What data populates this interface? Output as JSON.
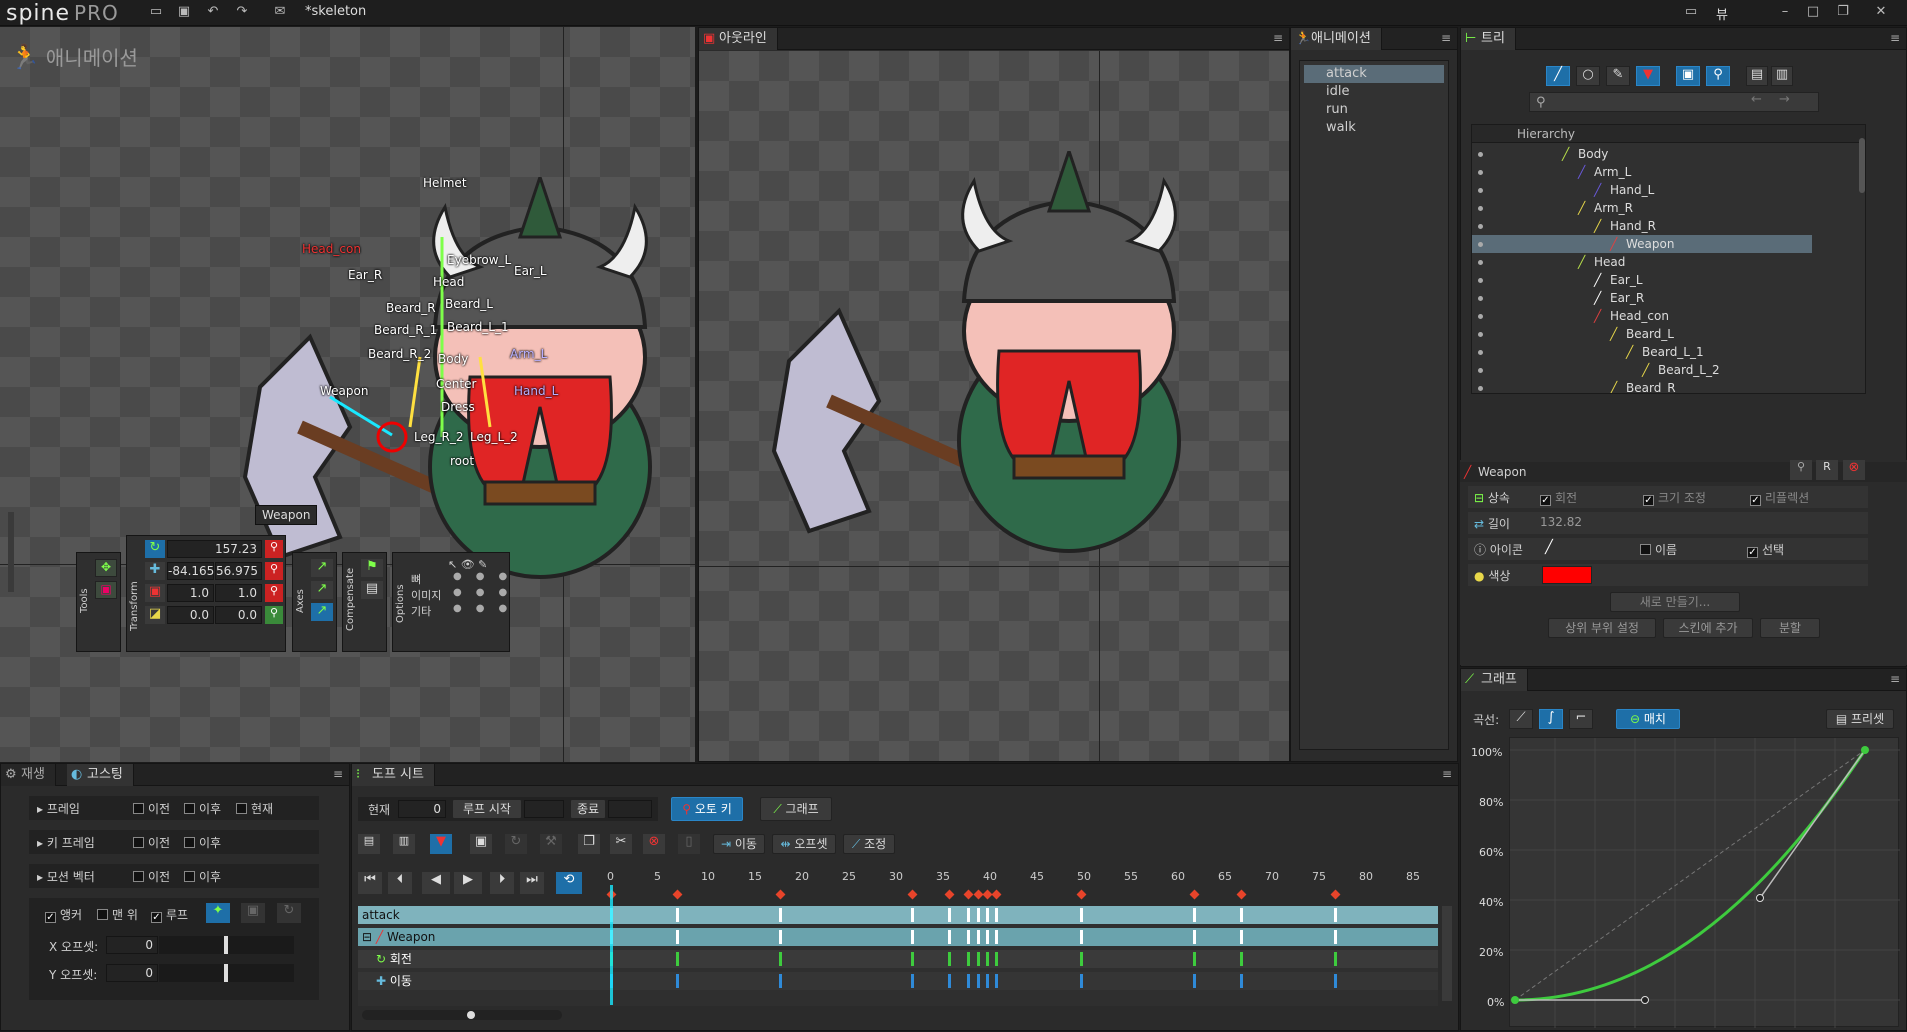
{
  "app": {
    "logo_main": "spine",
    "logo_pro": "PRO",
    "project": "*skeleton",
    "view_menu": "뷰"
  },
  "viewport": {
    "mode_label": "애니메이션",
    "selected_tag": "Weapon",
    "bones": [
      "Helmet",
      "Head_con",
      "Ear_R",
      "Eyebrow_L",
      "Ear_L",
      "Head",
      "Beard_R",
      "Beard_L",
      "Beard_R_1",
      "Beard_L_1",
      "Beard_R_2",
      "Arm_L",
      "Body",
      "Weapon",
      "Center",
      "Hand_L",
      "Dress",
      "Leg_R_2",
      "Leg_L_2",
      "root"
    ]
  },
  "transform": {
    "tools_label": "Tools",
    "transform_label": "Transform",
    "axes_label": "Axes",
    "compensate_label": "Compensate",
    "options_label": "Options",
    "rotate": "157.23",
    "translate_x": "-84.165",
    "translate_y": "56.975",
    "scale_x": "1.0",
    "scale_y": "1.0",
    "shear_x": "0.0",
    "shear_y": "0.0",
    "options_rows": [
      "뼈",
      "이미지",
      "기타"
    ]
  },
  "outline": {
    "tab": "아웃라인"
  },
  "animations": {
    "tab": "애니메이션",
    "items": [
      "attack",
      "idle",
      "run",
      "walk"
    ]
  },
  "tree": {
    "tab": "트리",
    "hierarchy": "Hierarchy",
    "rows": [
      {
        "label": "Body",
        "indent": 5,
        "color": "#b8e04a"
      },
      {
        "label": "Arm_L",
        "indent": 6,
        "color": "#6a5adf"
      },
      {
        "label": "Hand_L",
        "indent": 7,
        "color": "#6a5adf"
      },
      {
        "label": "Arm_R",
        "indent": 6,
        "color": "#e8d84a"
      },
      {
        "label": "Hand_R",
        "indent": 7,
        "color": "#e8d84a"
      },
      {
        "label": "Weapon",
        "indent": 8,
        "color": "#e04040"
      },
      {
        "label": "Head",
        "indent": 6,
        "color": "#b8e04a"
      },
      {
        "label": "Ear_L",
        "indent": 7,
        "color": "#ffffff"
      },
      {
        "label": "Ear_R",
        "indent": 7,
        "color": "#ffffff"
      },
      {
        "label": "Head_con",
        "indent": 7,
        "color": "#e04040"
      },
      {
        "label": "Beard_L",
        "indent": 8,
        "color": "#e8d84a"
      },
      {
        "label": "Beard_L_1",
        "indent": 9,
        "color": "#e8d84a"
      },
      {
        "label": "Beard_L_2",
        "indent": 10,
        "color": "#e8d84a"
      },
      {
        "label": "Beard_R",
        "indent": 8,
        "color": "#e8d84a"
      }
    ]
  },
  "props": {
    "title": "Weapon",
    "inherit_label": "상속",
    "inherit_rotate": "회전",
    "inherit_scale": "크기 조정",
    "inherit_reflect": "리플렉션",
    "length_label": "길이",
    "length_value": "132.82",
    "icon_label": "아이콘",
    "name_label": "이름",
    "select_label": "선택",
    "color_label": "색상",
    "color_value": "#ff0000",
    "new_button": "새로 만들기...",
    "set_parent": "상위 부위 설정",
    "add_skin": "스킨에 추가",
    "split": "분할"
  },
  "graph": {
    "tab": "그래프",
    "curve_label": "곡선:",
    "match_label": "매치",
    "preset_label": "프리셋",
    "y_labels": [
      "100%",
      "80%",
      "60%",
      "40%",
      "20%",
      "0%"
    ]
  },
  "playback": {
    "tab": "재생",
    "ghost_tab": "고스팅",
    "rows": [
      {
        "label": "프레임",
        "opts": [
          "이전",
          "이후",
          "현재"
        ]
      },
      {
        "label": "키 프레임",
        "opts": [
          "이전",
          "이후"
        ]
      },
      {
        "label": "모션 벡터",
        "opts": [
          "이전",
          "이후"
        ]
      }
    ],
    "anchor": "앵커",
    "top": "맨 위",
    "loop": "루프",
    "x_offset_label": "X 오프셋:",
    "x_offset": "0",
    "y_offset_label": "Y 오프셋:",
    "y_offset": "0"
  },
  "dopesheet": {
    "tab": "도프 시트",
    "current_label": "현재",
    "current_value": "0",
    "loop_start_label": "루프 시작",
    "end_label": "종료",
    "autokey": "오토 키",
    "graph_btn": "그래프",
    "move": "이동",
    "offset": "오프셋",
    "adjust": "조정",
    "ticks": [
      "0",
      "5",
      "10",
      "15",
      "20",
      "25",
      "30",
      "35",
      "40",
      "45",
      "50",
      "55",
      "60",
      "65",
      "70",
      "75",
      "80",
      "85"
    ],
    "tracks": [
      "attack",
      "Weapon",
      "회전",
      "이동"
    ],
    "key_frames": [
      0,
      7,
      18,
      32,
      36,
      38,
      39,
      40,
      41,
      50,
      62,
      67,
      77
    ]
  }
}
